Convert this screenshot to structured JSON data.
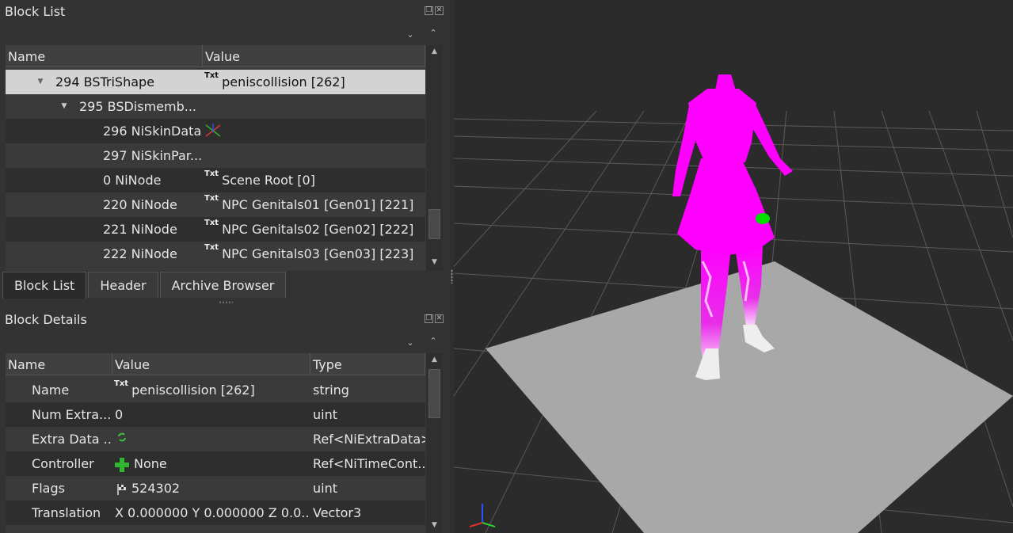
{
  "block_list": {
    "title": "Block List",
    "columns": [
      "Name",
      "Value"
    ],
    "rows": [
      {
        "name": "294 BSTriShape",
        "value": "peniscollision [262]",
        "txt": "Txt"
      },
      {
        "name": "295 BSDismemb...",
        "value": "",
        "txt": ""
      },
      {
        "name": "296 NiSkinData",
        "value": "",
        "txt": ""
      },
      {
        "name": "297 NiSkinPar...",
        "value": "",
        "txt": ""
      },
      {
        "name": "0 NiNode",
        "value": "Scene Root [0]",
        "txt": "Txt"
      },
      {
        "name": "220 NiNode",
        "value": "NPC Genitals01 [Gen01] [221]",
        "txt": "Txt"
      },
      {
        "name": "221 NiNode",
        "value": "NPC Genitals02 [Gen02] [222]",
        "txt": "Txt"
      },
      {
        "name": "222 NiNode",
        "value": "NPC Genitals03 [Gen03] [223]",
        "txt": "Txt"
      }
    ]
  },
  "tabs": [
    "Block List",
    "Header",
    "Archive Browser"
  ],
  "block_details": {
    "title": "Block Details",
    "columns": [
      "Name",
      "Value",
      "Type"
    ],
    "rows": [
      {
        "name": "Name",
        "value": "peniscollision [262]",
        "type": "string",
        "txt": "Txt"
      },
      {
        "name": "Num Extra...",
        "value": "0",
        "type": "uint",
        "txt": ""
      },
      {
        "name": "Extra Data ...",
        "value": "",
        "type": "Ref<NiExtraData>",
        "txt": ""
      },
      {
        "name": "Controller",
        "value": "None",
        "type": "Ref<NiTimeCont...",
        "txt": ""
      },
      {
        "name": "Flags",
        "value": "524302",
        "type": "uint",
        "txt": ""
      },
      {
        "name": "Translation",
        "value": "X 0.000000 Y 0.000000 Z 0.0...",
        "type": "Vector3",
        "txt": ""
      }
    ]
  },
  "colors": {
    "mesh": "#ff00ff",
    "selection": "#00e000",
    "ground": "#a8a8a8",
    "grid": "#5a5a5a"
  }
}
